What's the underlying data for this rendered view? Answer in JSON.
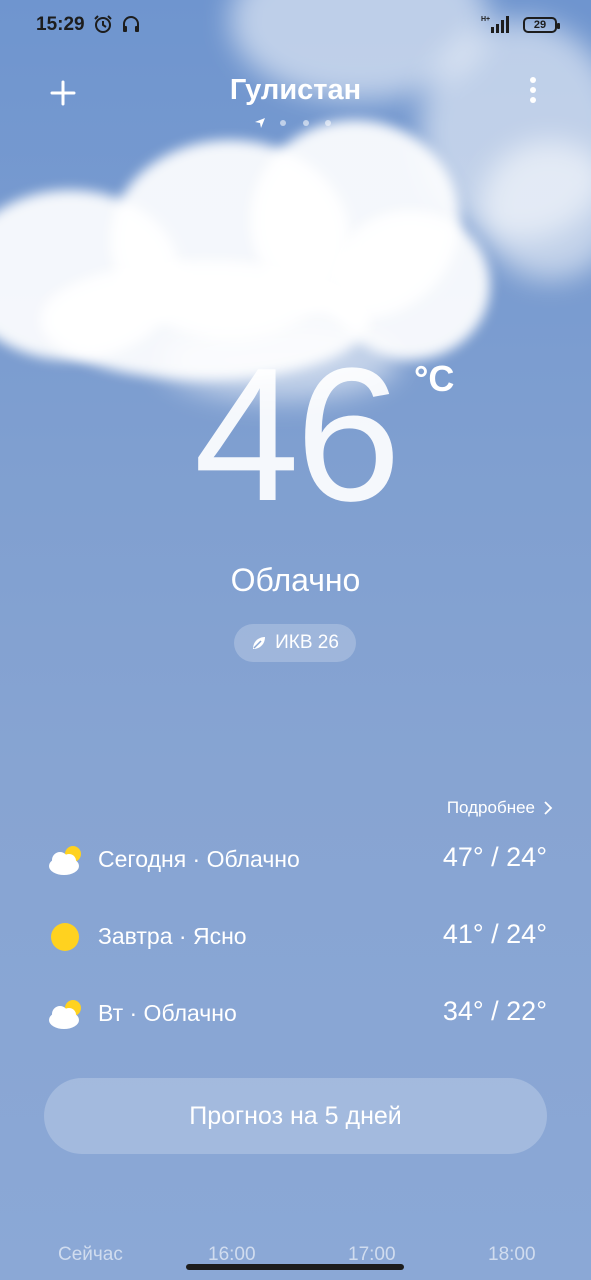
{
  "status_bar": {
    "time": "15:29",
    "network": "H+",
    "battery": "29"
  },
  "header": {
    "city": "Гулистан",
    "page_count": 4,
    "active_page": 1
  },
  "current": {
    "temperature": "46",
    "unit": "°C",
    "condition": "Облачно",
    "aqi_label": "ИКВ 26"
  },
  "forecast": {
    "details_label": "Подробнее",
    "days": [
      {
        "label": "Сегодня · Облачно",
        "temps": "47° / 24°",
        "icon": "partly-cloudy-icon"
      },
      {
        "label": "Завтра · Ясно",
        "temps": "41° / 24°",
        "icon": "sun-icon"
      },
      {
        "label": "Вт · Облачно",
        "temps": "34° / 22°",
        "icon": "partly-cloudy-icon"
      }
    ],
    "five_day_button": "Прогноз на 5 дней"
  },
  "hourly": {
    "labels": [
      "Сейчас",
      "16:00",
      "17:00",
      "18:00"
    ]
  },
  "colors": {
    "sky": "#7f9fd0",
    "sun": "#ffd21f"
  }
}
